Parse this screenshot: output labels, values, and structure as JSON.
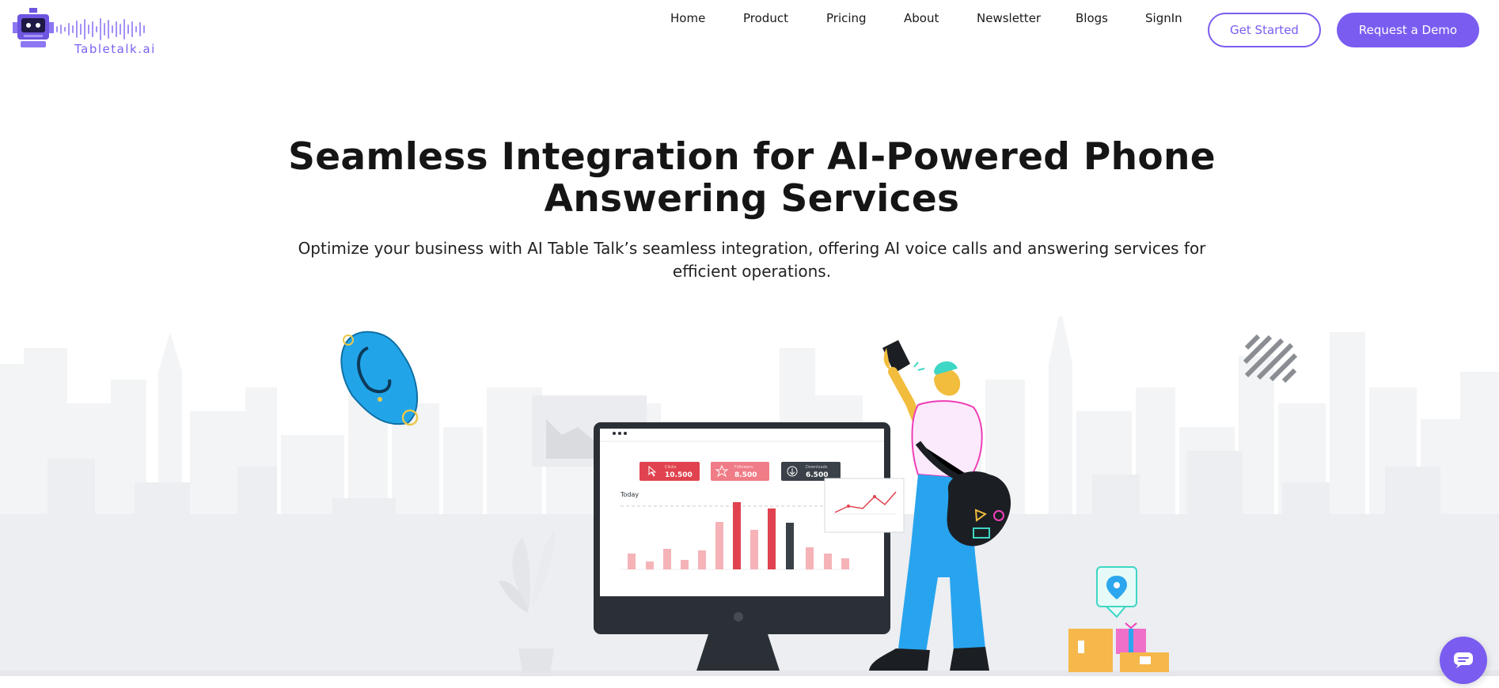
{
  "brand": {
    "name": "Tabletalk.ai",
    "accent": "#7b5cf0"
  },
  "nav": {
    "items": [
      {
        "label": "Home"
      },
      {
        "label": "Product"
      },
      {
        "label": "Pricing"
      },
      {
        "label": "About"
      },
      {
        "label": "Newsletter"
      },
      {
        "label": "Blogs"
      },
      {
        "label": "SignIn"
      }
    ],
    "get_started": "Get Started",
    "request_demo": "Request a Demo"
  },
  "hero": {
    "title_line1": "Seamless Integration for AI-Powered Phone",
    "title_line2": "Answering Services",
    "subtitle_line1": "Optimize your business with AI Table Talk’s seamless integration, offering AI voice calls and answering services for",
    "subtitle_line2": "efficient operations."
  },
  "dashboard": {
    "cards": [
      {
        "label": "Clicks",
        "value": "10.500",
        "color": "#e0434f",
        "icon": "cursor-icon"
      },
      {
        "label": "Followers",
        "value": "8.500",
        "color": "#ef7c86",
        "icon": "star-icon"
      },
      {
        "label": "Downloads",
        "value": "6.500",
        "color": "#3a4148",
        "icon": "download-icon"
      }
    ],
    "chart_label": "Today"
  },
  "chat_widget": {
    "icon": "chat-bubble-icon"
  }
}
